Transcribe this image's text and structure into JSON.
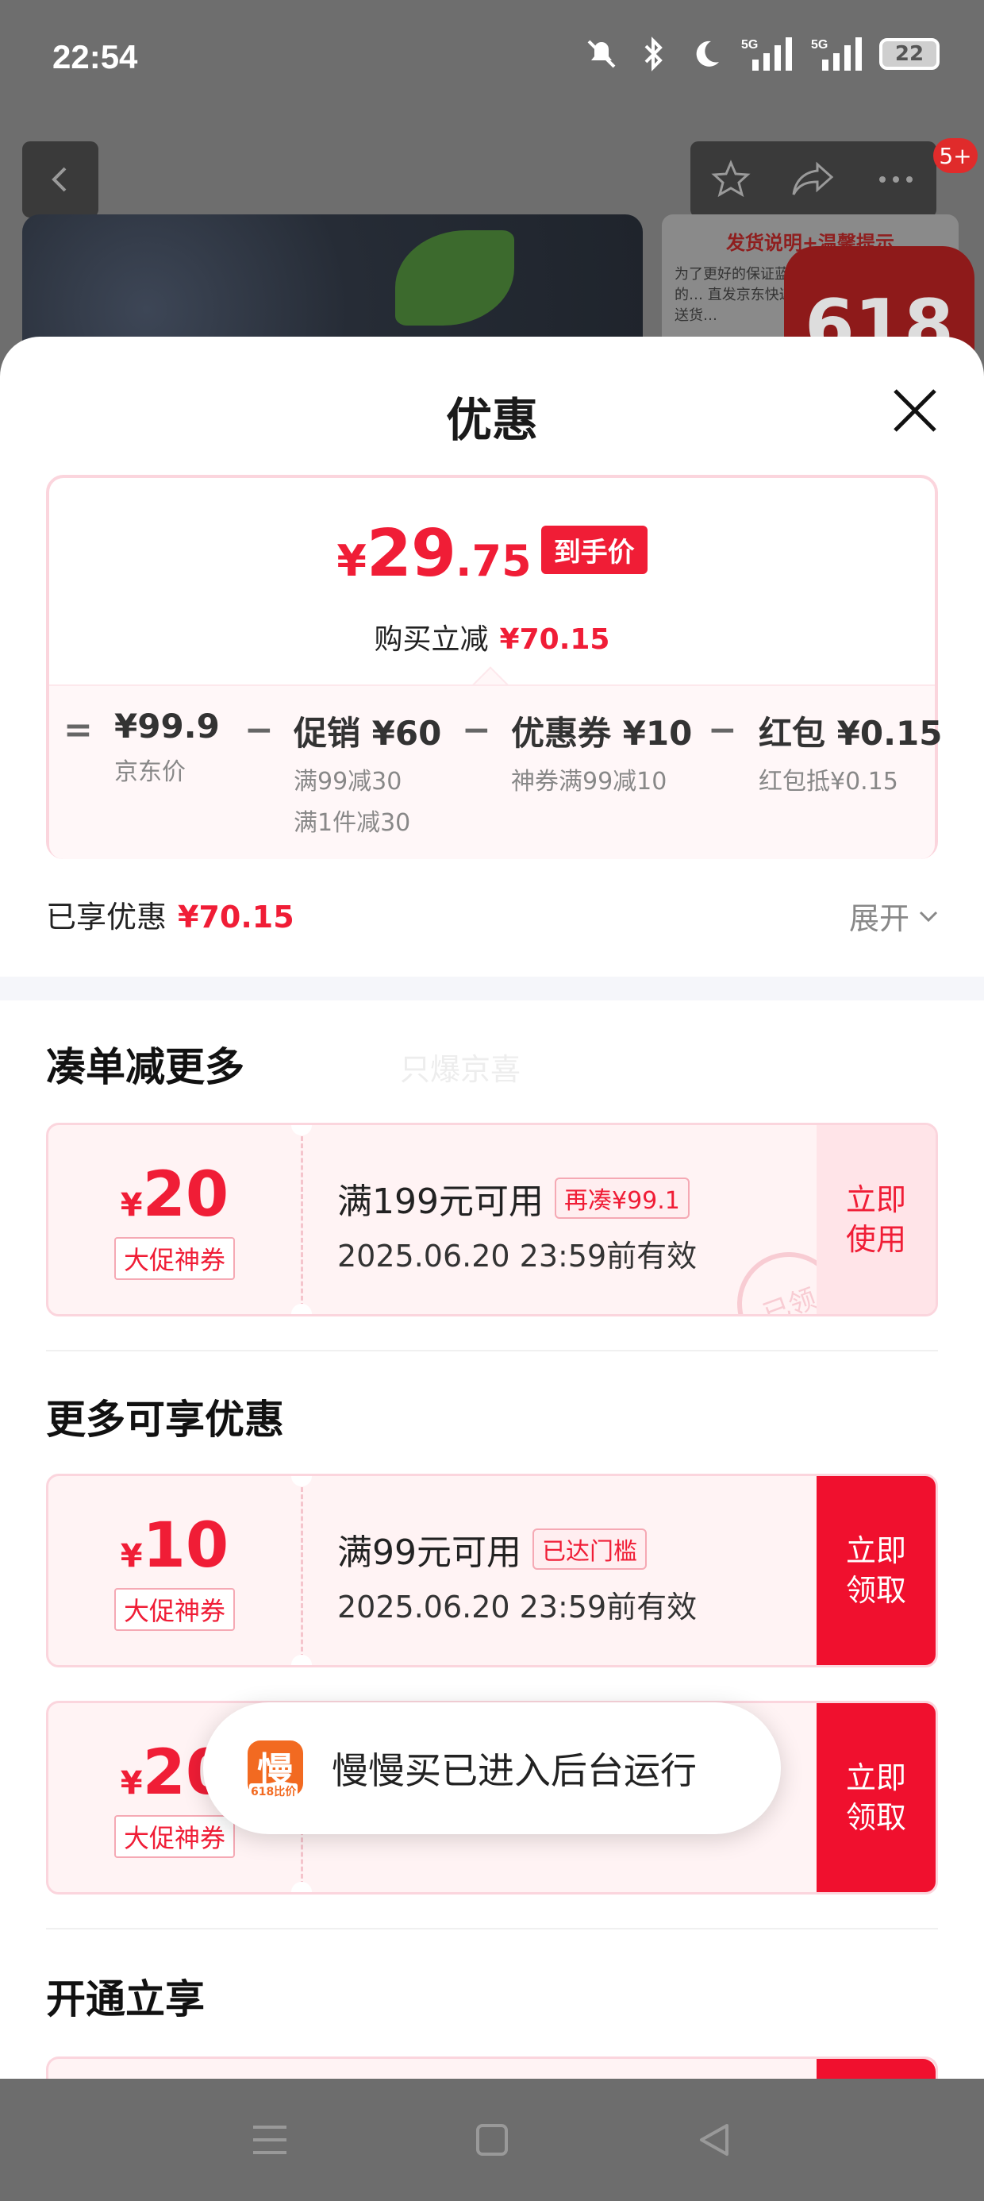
{
  "status_bar": {
    "time": "22:54",
    "battery": "22",
    "signal1": "5G",
    "signal2": "5G"
  },
  "backdrop": {
    "badge": "5+",
    "side_card_title": "发货说明+温馨提示",
    "side_card_text": "为了更好的保证蓝莓的… 直发京东快递，送货…",
    "promo": "618"
  },
  "sheet": {
    "title": "优惠",
    "price": {
      "currency": "¥",
      "integer": "29",
      "decimal": ".75",
      "tag": "到手价",
      "sub_label": "购买立减",
      "sub_value": "¥70.15"
    },
    "breakdown": {
      "eq": "=",
      "minus": "−",
      "items": [
        {
          "value": "¥99.9",
          "label": "京东价",
          "label2": ""
        },
        {
          "value": "促销 ¥60",
          "label": "满99减30",
          "label2": "满1件减30"
        },
        {
          "value": "优惠券 ¥10",
          "label": "神券满99减10",
          "label2": ""
        },
        {
          "value": "红包 ¥0.15",
          "label": "红包抵¥0.15",
          "label2": ""
        }
      ]
    },
    "enjoyed": {
      "label": "已享优惠",
      "value": "¥70.15",
      "expand": "展开"
    },
    "section1": {
      "title": "凑单减更多",
      "watermark": "只爆京喜"
    },
    "coupon1": {
      "currency": "¥",
      "amount": "20",
      "type": "大促神券",
      "condition": "满199元可用",
      "hint": "再凑¥99.1",
      "valid": "2025.06.20 23:59前有效",
      "action": "立即使用",
      "stamp": "已领"
    },
    "section2": {
      "title": "更多可享优惠"
    },
    "coupon2": {
      "currency": "¥",
      "amount": "10",
      "type": "大促神券",
      "condition": "满99元可用",
      "hint": "已达门槛",
      "valid": "2025.06.20 23:59前有效",
      "action": "立即领取"
    },
    "coupon3": {
      "currency": "¥",
      "amount": "20",
      "type": "大促神券",
      "action": "立即领取"
    },
    "section3": {
      "title": "开通立享"
    }
  },
  "toast": {
    "icon_text": "慢",
    "icon_sub": "618比价",
    "message": "慢慢买已进入后台运行"
  },
  "colors": {
    "accent": "#f01d36",
    "accent_solid": "#f0102e",
    "border": "#fbd5dd"
  }
}
